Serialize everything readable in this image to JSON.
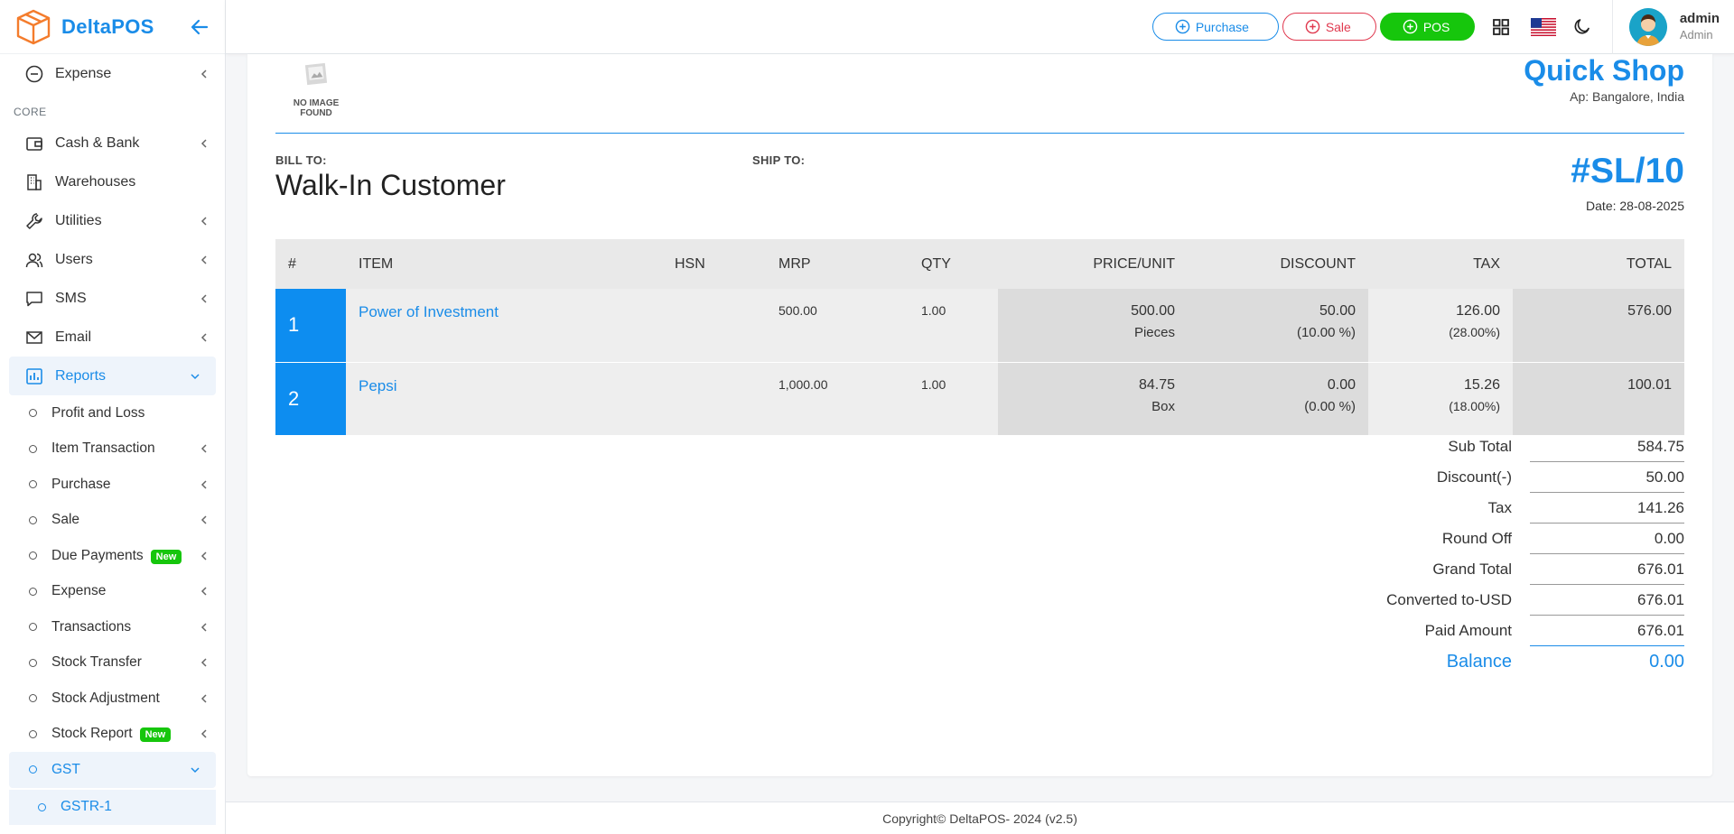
{
  "brand": {
    "name": "DeltaPOS"
  },
  "sidebar": {
    "top_item": {
      "label": "Expense"
    },
    "section_core": "CORE",
    "items": [
      {
        "label": "Cash & Bank"
      },
      {
        "label": "Warehouses"
      },
      {
        "label": "Utilities"
      },
      {
        "label": "Users"
      },
      {
        "label": "SMS"
      },
      {
        "label": "Email"
      },
      {
        "label": "Reports"
      }
    ],
    "reports_sub": [
      {
        "label": "Profit and Loss"
      },
      {
        "label": "Item Transaction"
      },
      {
        "label": "Purchase"
      },
      {
        "label": "Sale"
      },
      {
        "label": "Due Payments",
        "badge": "New"
      },
      {
        "label": "Expense"
      },
      {
        "label": "Transactions"
      },
      {
        "label": "Stock Transfer"
      },
      {
        "label": "Stock Adjustment"
      },
      {
        "label": "Stock Report",
        "badge": "New"
      },
      {
        "label": "GST"
      }
    ],
    "gst_sub": [
      {
        "label": "GSTR-1"
      }
    ]
  },
  "header": {
    "purchase_label": "Purchase",
    "sale_label": "Sale",
    "pos_label": "POS",
    "user_name": "admin",
    "user_role": "Admin"
  },
  "invoice": {
    "no_image_text": "NO IMAGE FOUND",
    "shop_name": "Quick Shop",
    "shop_address": "Ap: Bangalore, India",
    "bill_to_label": "BILL TO:",
    "customer": "Walk-In Customer",
    "ship_to_label": "SHIP TO:",
    "number": "#SL/10",
    "date": "Date: 28-08-2025",
    "columns": [
      "#",
      "ITEM",
      "HSN",
      "MRP",
      "QTY",
      "PRICE/UNIT",
      "DISCOUNT",
      "TAX",
      "TOTAL"
    ],
    "rows": [
      {
        "n": "1",
        "item": "Power of Investment",
        "hsn": "",
        "mrp": "500.00",
        "qty": "1.00",
        "price": "500.00",
        "unit": "Pieces",
        "discount": "50.00",
        "discount_pct": "(10.00 %)",
        "tax": "126.00",
        "tax_pct": "(28.00%)",
        "total": "576.00"
      },
      {
        "n": "2",
        "item": "Pepsi",
        "hsn": "",
        "mrp": "1,000.00",
        "qty": "1.00",
        "price": "84.75",
        "unit": "Box",
        "discount": "0.00",
        "discount_pct": "(0.00 %)",
        "tax": "15.26",
        "tax_pct": "(18.00%)",
        "total": "100.01"
      }
    ],
    "totals": [
      {
        "label": "Sub Total",
        "value": "584.75"
      },
      {
        "label": "Discount(-)",
        "value": "50.00"
      },
      {
        "label": "Tax",
        "value": "141.26"
      },
      {
        "label": "Round Off",
        "value": "0.00"
      },
      {
        "label": "Grand Total",
        "value": "676.01"
      },
      {
        "label": "Converted to-USD",
        "value": "676.01"
      },
      {
        "label": "Paid Amount",
        "value": "676.01"
      }
    ],
    "balance_label": "Balance",
    "balance_value": "0.00"
  },
  "footer": {
    "text": "Copyright© DeltaPOS- 2024 (v2.5)"
  },
  "colors": {
    "accent": "#1a8ce8",
    "sale": "#e0394f",
    "pos": "#16c60c"
  }
}
